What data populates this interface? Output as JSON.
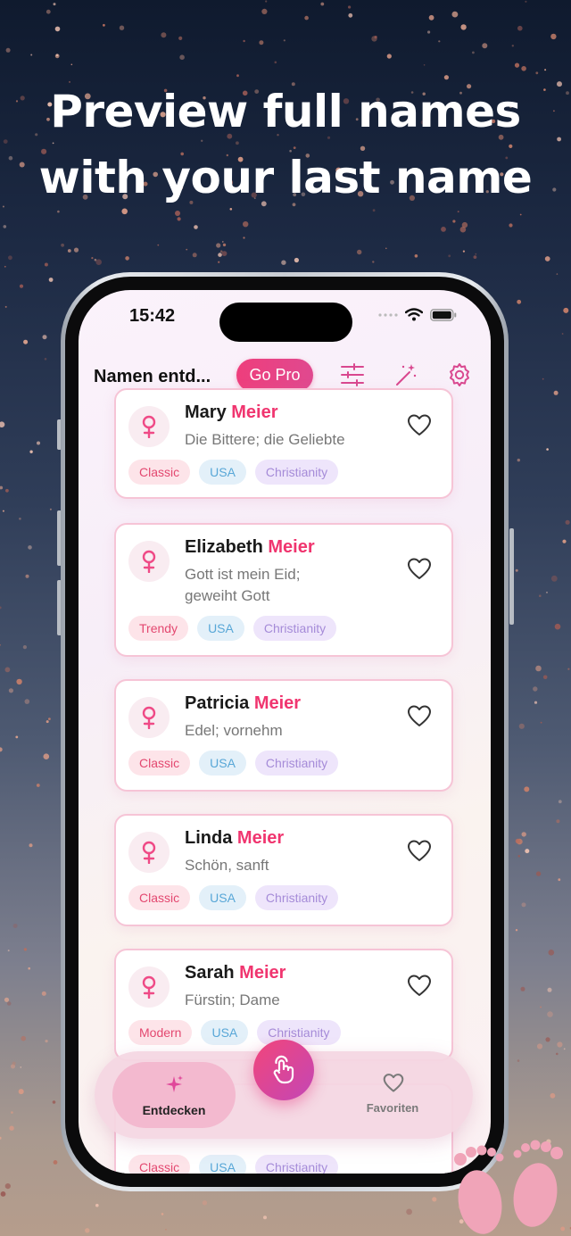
{
  "headline": {
    "line1": "Preview full names",
    "line2": "with your last name"
  },
  "status": {
    "time": "15:42"
  },
  "header": {
    "title": "Namen entd...",
    "go_pro": "Go Pro"
  },
  "icons": {
    "filter": "sliders-icon",
    "magic": "magic-wand-icon",
    "settings": "gear-icon",
    "gender": "female-icon",
    "favorite": "heart-icon",
    "discover": "sparkles-icon",
    "swipe": "tap-hand-icon"
  },
  "colors": {
    "accent": "#f0356f",
    "tab_active_bg": "#f3b9cf"
  },
  "names": [
    {
      "first": "Mary",
      "last": "Meier",
      "meaning": "Die Bittere; die Geliebte",
      "tags": [
        "Classic",
        "USA",
        "Christianity"
      ]
    },
    {
      "first": "Elizabeth",
      "last": "Meier",
      "meaning": "Gott ist mein Eid; geweiht Gott",
      "tags": [
        "Trendy",
        "USA",
        "Christianity"
      ]
    },
    {
      "first": "Patricia",
      "last": "Meier",
      "meaning": "Edel; vornehm",
      "tags": [
        "Classic",
        "USA",
        "Christianity"
      ]
    },
    {
      "first": "Linda",
      "last": "Meier",
      "meaning": "Schön, sanft",
      "tags": [
        "Classic",
        "USA",
        "Christianity"
      ]
    },
    {
      "first": "Sarah",
      "last": "Meier",
      "meaning": "Fürstin; Dame",
      "tags": [
        "Modern",
        "USA",
        "Christianity"
      ]
    },
    {
      "first": "",
      "last": "",
      "meaning": "",
      "tags": [
        "Classic",
        "USA",
        "Christianity"
      ]
    }
  ],
  "tabbar": {
    "discover": "Entdecken",
    "favorites": "Favoriten"
  }
}
